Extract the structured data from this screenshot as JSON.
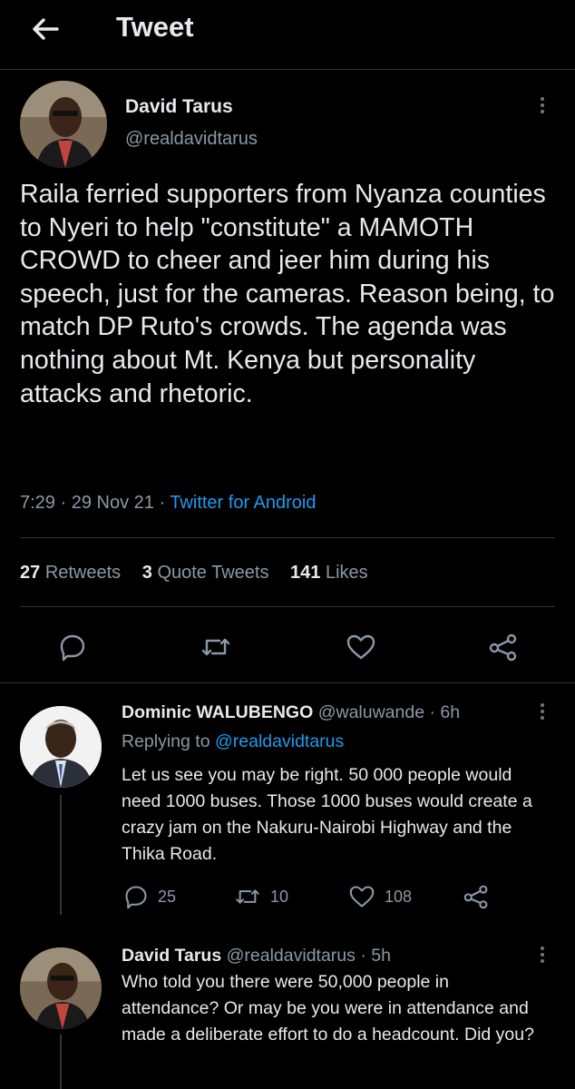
{
  "header": {
    "title": "Tweet",
    "back_icon": "arrow-left-icon"
  },
  "main_tweet": {
    "author_name": "David Tarus",
    "author_handle": "@realdavidtarus",
    "text": "Raila ferried supporters from Nyanza counties to Nyeri to help \"constitute\" a MAMOTH CROWD to cheer and jeer him during his speech, just for the cameras. Reason being, to match DP Ruto's crowds. The agenda was nothing about Mt. Kenya but personality attacks and rhetoric.",
    "time": "7:29",
    "date": "29 Nov 21",
    "source": "Twitter for Android",
    "stats": {
      "retweets_count": "27",
      "retweets_label": "Retweets",
      "quotes_count": "3",
      "quotes_label": "Quote Tweets",
      "likes_count": "141",
      "likes_label": "Likes"
    }
  },
  "replies": [
    {
      "author_name": "Dominic WALUBENGO",
      "author_handle": "@waluwande",
      "time": "6h",
      "replying_label": "Replying to",
      "replying_to": "@realdavidtarus",
      "text": "Let us see  you may be right.  50 000 people would need 1000 buses. Those 1000 buses would create a crazy jam on the Nakuru-Nairobi Highway and the Thika Road.",
      "reply_count": "25",
      "retweet_count": "10",
      "like_count": "108"
    },
    {
      "author_name": "David Tarus",
      "author_handle": "@realdavidtarus",
      "time": "5h",
      "text": "Who told you there were 50,000 people in attendance? Or may be you were in attendance and made a deliberate effort to do a headcount. Did you?"
    }
  ],
  "colors": {
    "background": "#000000",
    "link": "#1d9bf0",
    "muted": "#8b98a5",
    "divider": "#2f3336"
  }
}
